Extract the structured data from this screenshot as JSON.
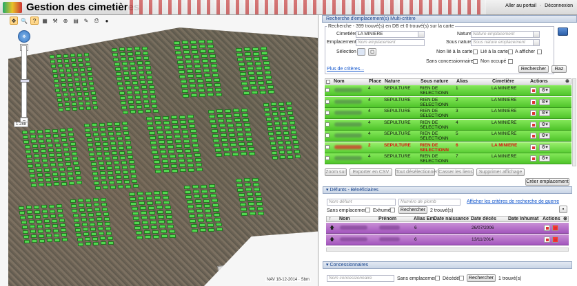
{
  "header": {
    "title": "Gestion des cimetières",
    "link_portal": "Aller au portail",
    "separator": "·",
    "link_logout": "Déconnexion"
  },
  "map": {
    "scale_label": "1:288",
    "footer": "NAV 18-12-2014 · Sbm"
  },
  "search_panel": {
    "title": "Recherche d'emplacement(s) Multi-critère",
    "legend": "Recherche - 399 trouvé(s) en DB et 0 trouvé(s) sur la carte",
    "cimetiere_label": "Cimetière",
    "cimetiere_value": "LA MINIERE",
    "nature_label": "Nature",
    "nature_placeholder": "Nature emplacement",
    "emplacement_label": "Emplacement",
    "emplacement_placeholder": "Nom emplacement",
    "sous_nature_label": "Sous nature",
    "sous_nature_placeholder": "Sous nature emplacement",
    "selection_label": "Sélection",
    "non_lie_label": "Non lié à la carte",
    "lie_label": "Lié à la carte",
    "a_afficher_label": "A afficher",
    "sans_concessionnaire_label": "Sans concessionnaire",
    "non_occupe_label": "Non occupé",
    "plus_criteres": "Plus de critères...",
    "rechercher_btn": "Rechercher",
    "raz_btn": "Raz"
  },
  "results": {
    "columns": [
      "Nom",
      "Place",
      "Nature",
      "Sous nature",
      "Alias",
      "Cimetière",
      "Actions"
    ],
    "rows": [
      {
        "place": "4",
        "nature": "SEPULTURE",
        "sous_nature": "RIEN DE SELECTIONNE",
        "alias": "1",
        "cimetiere": "LA MINIERE"
      },
      {
        "place": "4",
        "nature": "SEPULTURE",
        "sous_nature": "RIEN DE SELECTIONNE",
        "alias": "2",
        "cimetiere": "LA MINIERE"
      },
      {
        "place": "4",
        "nature": "SEPULTURE",
        "sous_nature": "RIEN DE SELECTIONNE",
        "alias": "3",
        "cimetiere": "LA MINIERE"
      },
      {
        "place": "4",
        "nature": "SEPULTURE",
        "sous_nature": "RIEN DE SELECTIONNE",
        "alias": "4",
        "cimetiere": "LA MINIERE"
      },
      {
        "place": "4",
        "nature": "SEPULTURE",
        "sous_nature": "RIEN DE SELECTIONNE",
        "alias": "5",
        "cimetiere": "LA MINIERE"
      },
      {
        "place": "2",
        "nature": "SEPULTURE",
        "sous_nature": "RIEN DE SELECTIONNE",
        "alias": "6",
        "cimetiere": "LA MINIERE"
      },
      {
        "place": "4",
        "nature": "SEPULTURE",
        "sous_nature": "RIEN DE SELECTIONNE",
        "alias": "7",
        "cimetiere": "LA MINIERE"
      }
    ],
    "toolbar": {
      "zoom": "Zoom sur",
      "export": "Exporter en CSV",
      "unselect": "Tout désélectionner",
      "cut_links": "Casser les liens",
      "delete_display": "Supprimer affichage",
      "create": "Créer emplacement"
    }
  },
  "defunts": {
    "header": "▾ Défunts - Bénéficiaires",
    "defunt_placeholder": "Nom défunt",
    "plot_placeholder": "Numéro de plomb",
    "show_criteria_link": "Afficher les critères de recherche de guerre",
    "sans_emplacement": "Sans emplacement",
    "exhume": "Exhumé",
    "search_btn": "Rechercher",
    "count": "2 trouvé(s)",
    "columns": [
      "Nom",
      "Prénom",
      "Alias Em",
      "Date naissance",
      "Date décès",
      "Date Inhumat",
      "Actions"
    ],
    "rows": [
      {
        "alias": "6",
        "deces": "26/07/2006"
      },
      {
        "alias": "6",
        "deces": "13/11/2014"
      }
    ]
  },
  "concessionnaires": {
    "header": "▾ Concessionnaires",
    "placeholder": "Nom concessionnaire",
    "sans_emplacement": "Sans emplacement",
    "decede": "Décédé",
    "search_btn": "Rechercher",
    "count": "1 trouvé(s)"
  },
  "colors": {
    "grave_green": "#4fe34f",
    "row_green": "#4fc42a",
    "row_purple": "#a356bd",
    "accent_blue": "#15428b"
  }
}
